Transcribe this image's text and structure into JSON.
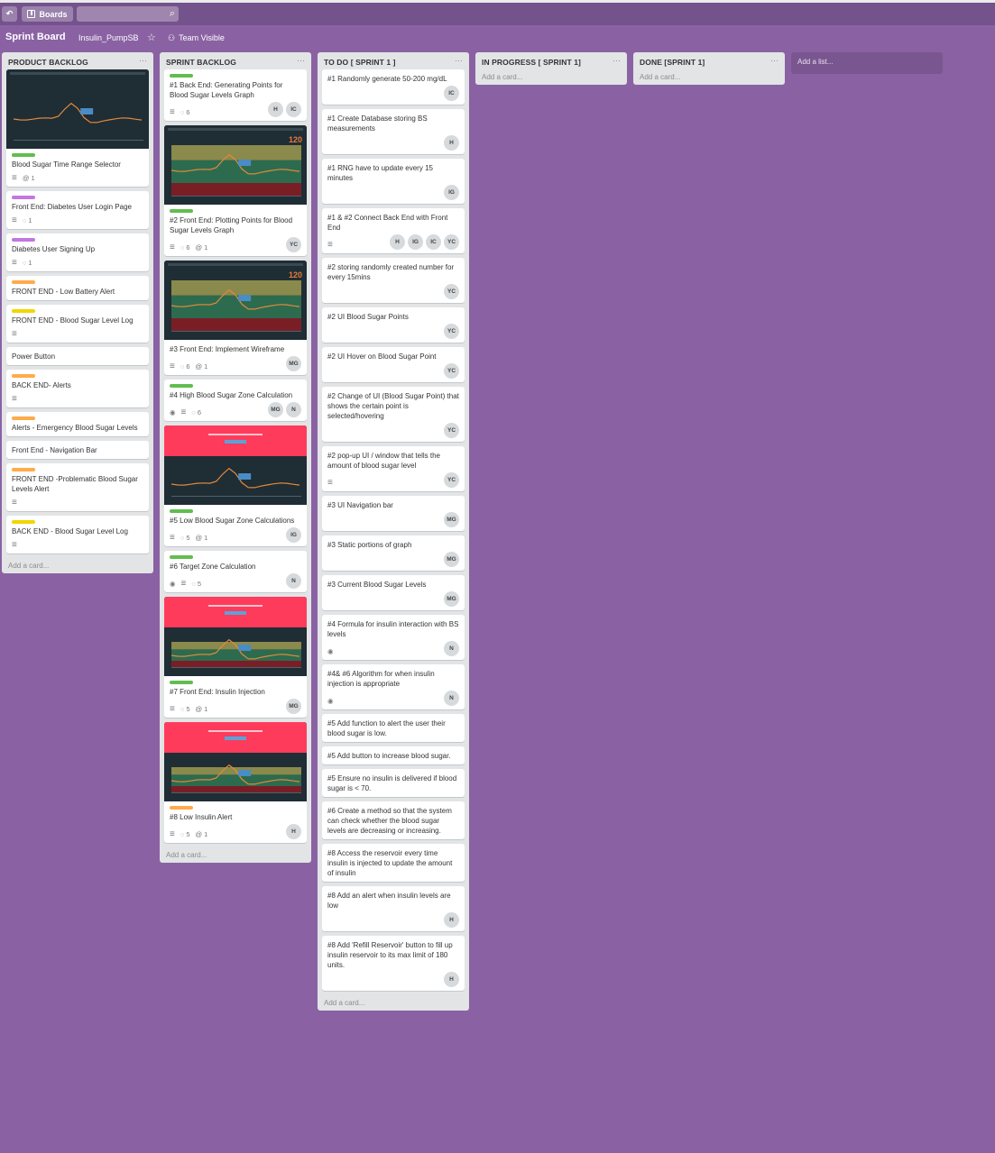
{
  "header": {
    "back_icon": "↶",
    "boards_label": "Boards",
    "search_placeholder": "",
    "search_icon": "⌕"
  },
  "board": {
    "title": "Sprint Board",
    "org": "Insulin_PumpSB",
    "star_icon": "☆",
    "visibility": "Team Visible",
    "visibility_icon": "👥"
  },
  "add_list_label": "Add a list...",
  "colors": {
    "green": "#61bd4f",
    "purple": "#c377e0",
    "orange": "#ffab4a",
    "yellow": "#f2d600",
    "red": "#ff3b5c"
  },
  "lists": [
    {
      "title": "PRODUCT BACKLOG",
      "add_card": "Add a card...",
      "cards": [
        {
          "title": "Blood Sugar Time Range Selector",
          "label": "green",
          "desc": true,
          "attach": "1",
          "cover": "dark"
        },
        {
          "title": "Front End: Diabetes User Login Page",
          "label": "purple",
          "desc": true,
          "comments": "1"
        },
        {
          "title": "Diabetes User Signing Up",
          "label": "purple",
          "desc": true,
          "comments": "1"
        },
        {
          "title": "FRONT END - Low Battery Alert",
          "label": "orange"
        },
        {
          "title": "FRONT END - Blood Sugar Level Log",
          "label": "yellow",
          "desc": true
        },
        {
          "title": "Power Button"
        },
        {
          "title": "BACK END- Alerts",
          "label": "orange",
          "desc": true
        },
        {
          "title": "Alerts - Emergency Blood Sugar Levels",
          "label": "orange"
        },
        {
          "title": "Front End - Navigation Bar"
        },
        {
          "title": "FRONT END -Problematic Blood Sugar Levels Alert",
          "label": "orange",
          "desc": true
        },
        {
          "title": "BACK END - Blood Sugar Level Log",
          "label": "yellow",
          "desc": true
        }
      ]
    },
    {
      "title": "SPRINT BACKLOG",
      "add_card": "Add a card...",
      "cards": [
        {
          "title": "#1 Back End: Generating Points for Blood Sugar Levels Graph",
          "label": "green",
          "desc": true,
          "comments": "6",
          "members": [
            "H",
            "IC"
          ]
        },
        {
          "title": "#2 Front End: Plotting Points for Blood Sugar Levels Graph",
          "label": "green",
          "desc": true,
          "comments": "6",
          "attach": "1",
          "members": [
            "YC"
          ],
          "cover": "zones"
        },
        {
          "title": "#3 Front End: Implement Wireframe",
          "desc": true,
          "comments": "6",
          "attach": "1",
          "members": [
            "MG"
          ],
          "cover": "zones"
        },
        {
          "title": "#4 High Blood Sugar Zone Calculation",
          "label": "green",
          "watch": true,
          "desc": true,
          "comments": "6",
          "members": [
            "MG",
            "N"
          ]
        },
        {
          "title": "#5 Low Blood Sugar Zone Calculations",
          "label": "green",
          "desc": true,
          "comments": "5",
          "attach": "1",
          "members": [
            "IG"
          ],
          "cover": "alert-dark"
        },
        {
          "title": "#6 Target Zone Calculation",
          "label": "green",
          "watch": true,
          "desc": true,
          "comments": "5",
          "members": [
            "N"
          ]
        },
        {
          "title": "#7 Front End: Insulin Injection",
          "label": "green",
          "desc": true,
          "comments": "5",
          "attach": "1",
          "members": [
            "MG"
          ],
          "cover": "alert-zones"
        },
        {
          "title": "#8 Low Insulin Alert",
          "label": "orange",
          "desc": true,
          "comments": "5",
          "attach": "1",
          "members": [
            "H"
          ],
          "cover": "alert-zones"
        }
      ]
    },
    {
      "title": "TO DO [ SPRINT 1 ]",
      "add_card": "Add a card...",
      "cards": [
        {
          "title": "#1 Randomly generate 50-200 mg/dL",
          "members": [
            "IC"
          ]
        },
        {
          "title": "#1 Create Database storing BS measurements",
          "members": [
            "H"
          ]
        },
        {
          "title": "#1 RNG have to update every 15 minutes",
          "members": [
            "IG"
          ]
        },
        {
          "title": "#1 & #2 Connect Back End with Front End",
          "desc": true,
          "members": [
            "H",
            "IG",
            "IC",
            "YC"
          ]
        },
        {
          "title": "#2 storing randomly created number for every 15mins",
          "members": [
            "YC"
          ]
        },
        {
          "title": "#2 UI Blood Sugar Points",
          "members": [
            "YC"
          ]
        },
        {
          "title": "#2 UI Hover on Blood Sugar Point",
          "members": [
            "YC"
          ]
        },
        {
          "title": "#2 Change of UI (Blood Sugar Point) that shows the certain point is selected/hovering",
          "members": [
            "YC"
          ]
        },
        {
          "title": "#2 pop-up UI / window that tells the amount of blood sugar level",
          "desc": true,
          "members": [
            "YC"
          ]
        },
        {
          "title": "#3 UI Navigation bar",
          "members": [
            "MG"
          ]
        },
        {
          "title": "#3 Static portions of graph",
          "members": [
            "MG"
          ]
        },
        {
          "title": "#3 Current Blood Sugar Levels",
          "members": [
            "MG"
          ]
        },
        {
          "title": "#4 Formula for insulin interaction with BS levels",
          "watch": true,
          "members": [
            "N"
          ]
        },
        {
          "title": "#4& #6 Algorithm for when insulin injection is appropriate",
          "watch": true,
          "members": [
            "N"
          ]
        },
        {
          "title": "#5 Add function to alert the user their blood sugar is low."
        },
        {
          "title": "#5 Add button to increase blood sugar."
        },
        {
          "title": "#5 Ensure no insulin is delivered if blood sugar is < 70."
        },
        {
          "title": "#6 Create a method so that the system can check whether the blood sugar levels are decreasing or increasing."
        },
        {
          "title": "#8 Access the reservoir every time insulin is injected to update the amount of insulin"
        },
        {
          "title": "#8 Add an alert when insulin levels are low",
          "members": [
            "H"
          ]
        },
        {
          "title": "#8 Add 'Refill Reservoir' button to fill up insulin reservoir to its max limit of 180 units.",
          "members": [
            "H"
          ]
        }
      ]
    },
    {
      "title": "IN PROGRESS [ SPRINT 1]",
      "add_card": "Add a card...",
      "cards": []
    },
    {
      "title": "DONE [SPRINT 1]",
      "add_card": "Add a card...",
      "cards": []
    }
  ]
}
